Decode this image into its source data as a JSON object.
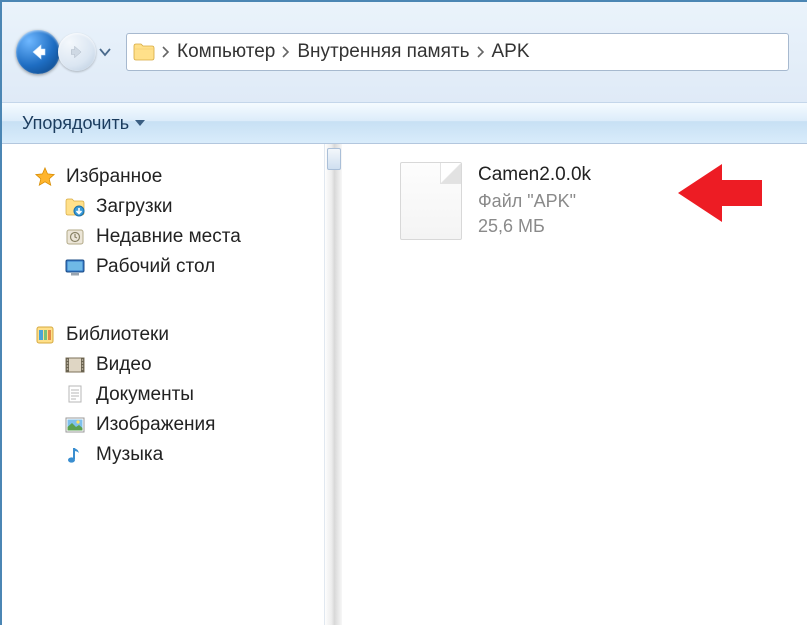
{
  "breadcrumb": {
    "items": [
      "Компьютер",
      "Внутренняя память",
      "APK"
    ]
  },
  "toolbar": {
    "organize_label": "Упорядочить"
  },
  "sidebar": {
    "favorites": {
      "title": "Избранное",
      "items": [
        {
          "label": "Загрузки"
        },
        {
          "label": "Недавние места"
        },
        {
          "label": "Рабочий стол"
        }
      ]
    },
    "libraries": {
      "title": "Библиотеки",
      "items": [
        {
          "label": "Видео"
        },
        {
          "label": "Документы"
        },
        {
          "label": "Изображения"
        },
        {
          "label": "Музыка"
        }
      ]
    }
  },
  "file": {
    "name": "Camen2.0.0k",
    "type": "Файл \"APK\"",
    "size": "25,6 МБ"
  }
}
